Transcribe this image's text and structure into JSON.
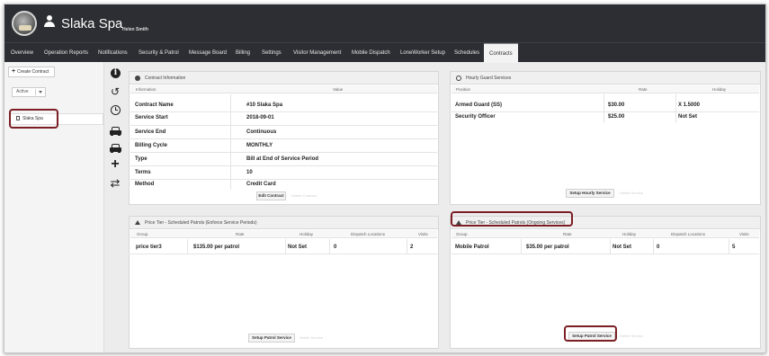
{
  "header": {
    "org_name": "Slaka Spa",
    "user_name": "Helen Smith"
  },
  "nav": {
    "items": [
      "Overview",
      "Operation Reports",
      "Notifications",
      "Security & Patrol",
      "Message Board",
      "Billing",
      "Settings",
      "Visitor Management",
      "Mobile Dispatch",
      "LoneWorker Setup",
      "Schedules",
      "Contracts"
    ],
    "active": "Contracts"
  },
  "sidebar": {
    "create_label": "Create Contract",
    "filter_value": "Active",
    "contract_label": "Slaka Spa"
  },
  "contract_info": {
    "title": "Contract Information",
    "col_info": "Information",
    "col_value": "Value",
    "rows": [
      {
        "label": "Contract Name",
        "value": "#10 Slaka Spa"
      },
      {
        "label": "Service Start",
        "value": "2018-09-01"
      },
      {
        "label": "Service End",
        "value": "Continuous"
      },
      {
        "label": "Billing Cycle",
        "value": "MONTHLY"
      },
      {
        "label": "Type",
        "value": "Bill at End of Service Period"
      },
      {
        "label": "Terms",
        "value": "10"
      },
      {
        "label": "Method",
        "value": "Credit Card"
      }
    ],
    "button": "Edit Contract",
    "ghost": "Delete Contract"
  },
  "hourly": {
    "title": "Hourly Guard Services",
    "cols": [
      "Position",
      "Rate",
      "Holiday"
    ],
    "rows": [
      {
        "position": "Armed Guard (SS)",
        "rate": "$30.00",
        "holiday": "X 1.5000"
      },
      {
        "position": "Security Officer",
        "rate": "$25.00",
        "holiday": "Not Set"
      }
    ],
    "button": "Setup Hourly Service",
    "ghost": "Delete Service"
  },
  "enforce": {
    "title": "Price Tier - Scheduled Patrols (Enforce Service Periods)",
    "cols": [
      "Group",
      "Rate",
      "Holiday",
      "Dispatch Locations",
      "Visits"
    ],
    "row": {
      "group": "price tier3",
      "rate": "$135.00 per patrol",
      "holiday": "Not Set",
      "locations": "0",
      "visits": "2"
    },
    "button": "Setup Patrol Service",
    "ghost": "Delete Service"
  },
  "ongoing": {
    "title": "Price Tier - Scheduled Patrols (Ongoing Services)",
    "cols": [
      "Group",
      "Rate",
      "Holiday",
      "Dispatch Locations",
      "Visits"
    ],
    "row": {
      "group": "Mobile Patrol",
      "rate": "$35.00 per patrol",
      "holiday": "Not Set",
      "locations": "0",
      "visits": "5"
    },
    "button": "Setup Patrol Service",
    "ghost": "Delete Service"
  }
}
